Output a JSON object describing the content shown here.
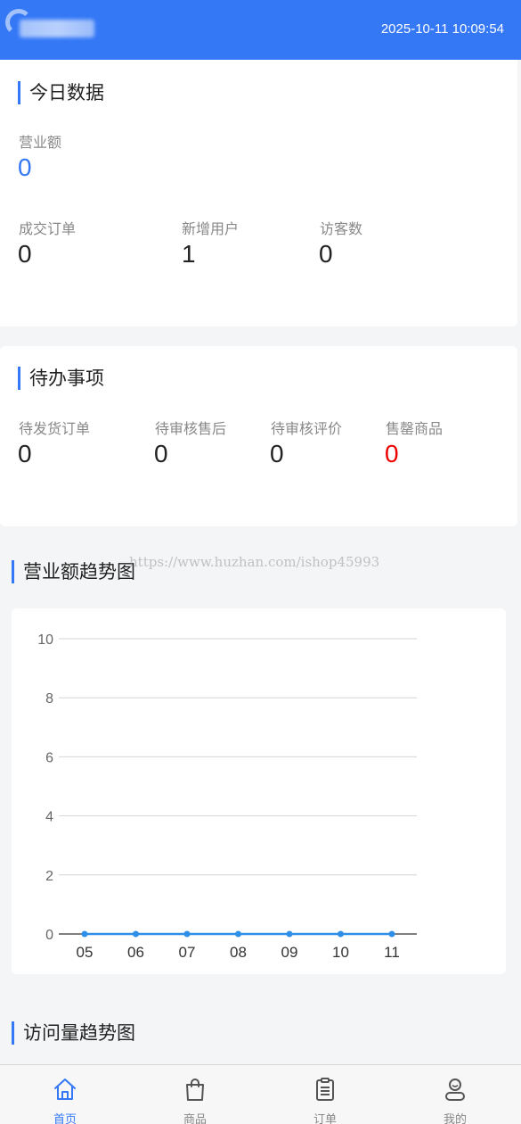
{
  "header": {
    "datetime": "2025-10-11 10:09:54"
  },
  "today": {
    "title": "今日数据",
    "revenue": {
      "label": "营业额",
      "value": "0"
    },
    "stats": [
      {
        "label": "成交订单",
        "value": "0"
      },
      {
        "label": "新增用户",
        "value": "1"
      },
      {
        "label": "访客数",
        "value": "0"
      }
    ]
  },
  "todo": {
    "title": "待办事项",
    "items": [
      {
        "label": "待发货订单",
        "value": "0"
      },
      {
        "label": "待审核售后",
        "value": "0"
      },
      {
        "label": "待审核评价",
        "value": "0"
      },
      {
        "label": "售罄商品",
        "value": "0"
      }
    ]
  },
  "watermark": "https://www.huzhan.com/ishop45993",
  "revenue_trend": {
    "title": "营业额趋势图"
  },
  "visit_trend": {
    "title": "访问量趋势图"
  },
  "chart_data": {
    "type": "line",
    "categories": [
      "05",
      "06",
      "07",
      "08",
      "09",
      "10",
      "11"
    ],
    "values": [
      0,
      0,
      0,
      0,
      0,
      0,
      0
    ],
    "title": "营业额趋势图",
    "xlabel": "",
    "ylabel": "",
    "ylim": [
      0,
      10
    ],
    "yticks": [
      0,
      2,
      4,
      6,
      8,
      10
    ],
    "grid": true,
    "series_color": "#2d8fe8"
  },
  "tabbar": {
    "items": [
      {
        "label": "首页",
        "icon": "home-icon",
        "active": true
      },
      {
        "label": "商品",
        "icon": "shopping-bag-icon",
        "active": false
      },
      {
        "label": "订单",
        "icon": "clipboard-icon",
        "active": false
      },
      {
        "label": "我的",
        "icon": "user-icon",
        "active": false
      }
    ]
  },
  "colors": {
    "accent": "#3478f6",
    "danger": "#e00000"
  }
}
